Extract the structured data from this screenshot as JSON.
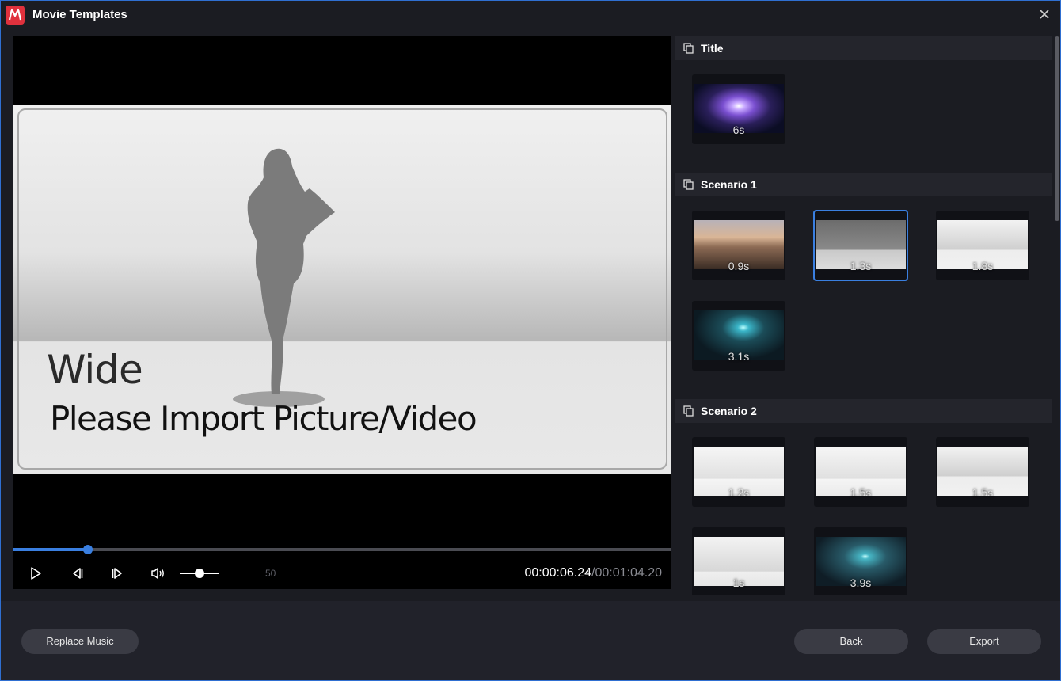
{
  "window": {
    "title": "Movie Templates",
    "accent": "#3a7fe0",
    "app_icon": "film-app-icon",
    "close_icon": "close-icon"
  },
  "preview": {
    "heading": "Wide",
    "subtitle": "Please Import Picture/Video",
    "progress_fraction": 0.113,
    "volume_fraction": 0.5,
    "volume_value": "50",
    "time_current": "00:00:06.24",
    "time_separator": "/",
    "time_total": "00:01:04.20"
  },
  "sections": [
    {
      "label": "Title",
      "thumbs": [
        {
          "duration": "6s"
        }
      ]
    },
    {
      "label": "Scenario 1",
      "thumbs": [
        {
          "duration": "0.9s"
        },
        {
          "duration": "1.3s"
        },
        {
          "duration": "1.8s"
        },
        {
          "duration": "3.1s"
        }
      ]
    },
    {
      "label": "Scenario 2",
      "thumbs": [
        {
          "duration": "1.2s"
        },
        {
          "duration": "1.5s"
        },
        {
          "duration": "1.5s"
        },
        {
          "duration": "1s"
        },
        {
          "duration": "3.9s"
        }
      ]
    }
  ],
  "footer": {
    "replace_music": "Replace Music",
    "back": "Back",
    "export": "Export"
  }
}
